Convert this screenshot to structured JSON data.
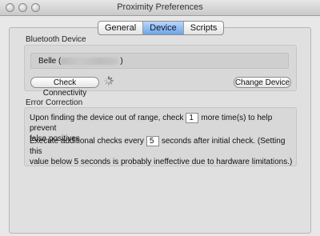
{
  "window": {
    "title": "Proximity Preferences"
  },
  "tabs": [
    {
      "label": "General",
      "active": false
    },
    {
      "label": "Device",
      "active": true
    },
    {
      "label": "Scripts",
      "active": false
    }
  ],
  "bluetooth": {
    "section_title": "Bluetooth Device",
    "device_name_prefix": "Belle (",
    "device_name_suffix": ")",
    "check_button": "Check Connectivity",
    "change_button": "Change Device"
  },
  "error_correction": {
    "section_title": "Error Correction",
    "range_check_before": "Upon finding the device out of range, check",
    "range_check_value": "1",
    "range_check_after": "more time(s) to help prevent",
    "range_check_line2": "false positives",
    "interval_before": "Execute additional checks every",
    "interval_value": "5",
    "interval_after": "seconds after initial check. (Setting this",
    "interval_line2": "value below 5 seconds is probably ineffective due to hardware limitations.)"
  },
  "colors": {
    "active_tab": "#6fa3e8",
    "window_bg": "#e8e8e8"
  }
}
